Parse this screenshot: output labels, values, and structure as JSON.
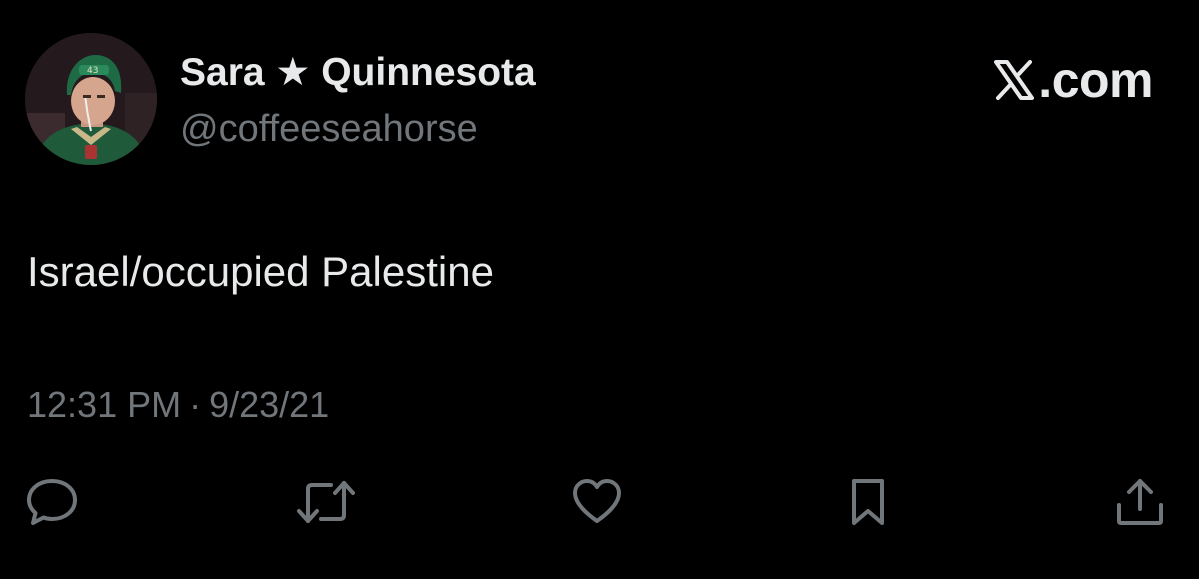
{
  "tweet": {
    "author": {
      "display_name": "Sara ★ Quinnesota",
      "handle": "@coffeeseahorse",
      "avatar": "hockey-player-avatar"
    },
    "brand": {
      "logo": "x-logo-icon",
      "text": ".com"
    },
    "text": "Israel/occupied Palestine",
    "time": "12:31 PM",
    "separator": "·",
    "date": "9/23/21",
    "actions": [
      {
        "name": "reply",
        "icon": "reply-icon"
      },
      {
        "name": "retweet",
        "icon": "retweet-icon"
      },
      {
        "name": "like",
        "icon": "heart-icon"
      },
      {
        "name": "bookmark",
        "icon": "bookmark-icon"
      },
      {
        "name": "share",
        "icon": "share-icon"
      }
    ]
  },
  "colors": {
    "background": "#000000",
    "primary_text": "#e7e9ea",
    "secondary_text": "#71767b",
    "icon": "#71767b"
  }
}
